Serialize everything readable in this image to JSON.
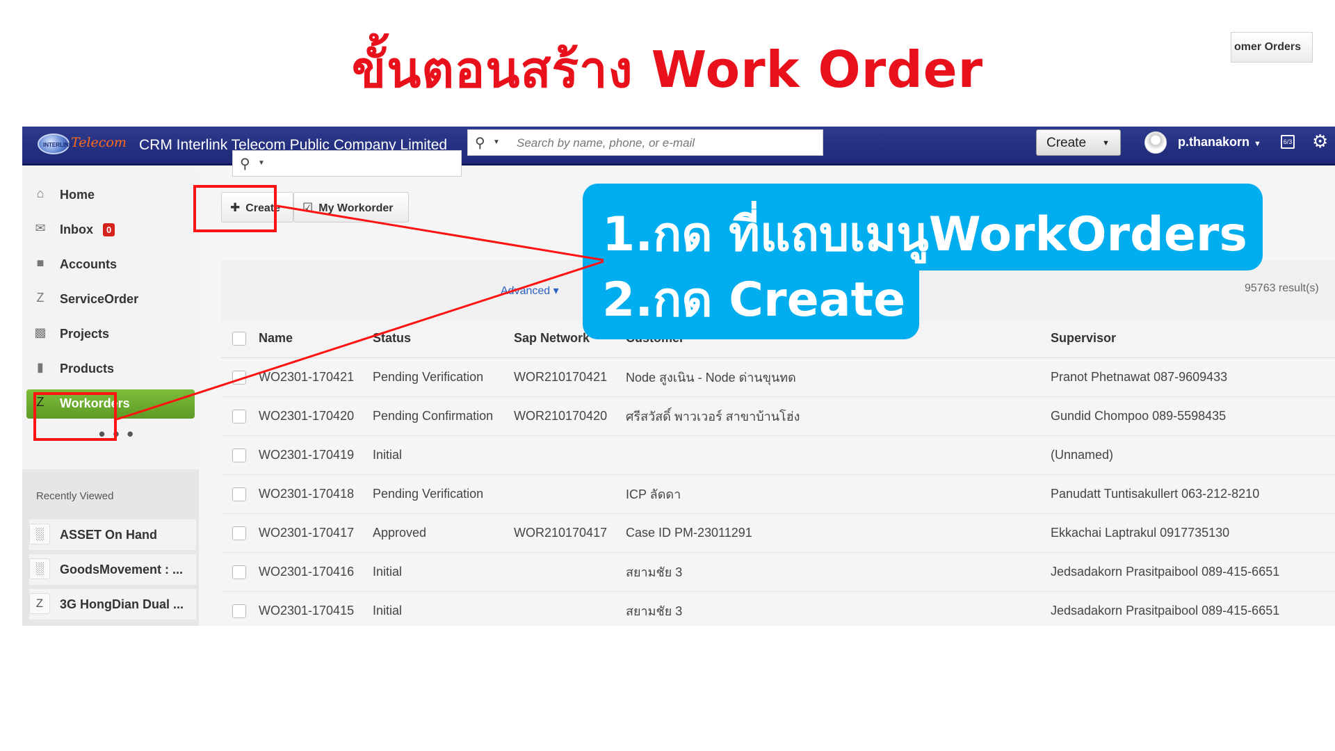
{
  "slide": {
    "title": "ขั้นตอนสร้าง Work Order"
  },
  "topbar": {
    "logo_text": "Telecom",
    "app_title": "CRM Interlink Telecom Public Company Limited",
    "search_placeholder": "Search by name, phone, or e-mail",
    "create_label": "Create",
    "username": "p.thanakorn",
    "icons": [
      "search-icon",
      "calendar-icon",
      "gear-icon"
    ]
  },
  "sidebar": {
    "items": [
      {
        "label": "Home",
        "icon": "home-icon"
      },
      {
        "label": "Inbox",
        "icon": "mail-icon",
        "badge": "0"
      },
      {
        "label": "Accounts",
        "icon": "folder-icon"
      },
      {
        "label": "ServiceOrder",
        "icon": "z-icon"
      },
      {
        "label": "Projects",
        "icon": "briefcase-icon"
      },
      {
        "label": "Products",
        "icon": "book-icon"
      },
      {
        "label": "Workorders",
        "icon": "z-icon",
        "active": true
      }
    ],
    "more": "• • •",
    "recent_title": "Recently Viewed",
    "recent_items": [
      {
        "label": "ASSET On Hand",
        "icon": "bar-chart-icon"
      },
      {
        "label": "GoodsMovement : ...",
        "icon": "bar-chart-icon"
      },
      {
        "label": "3G HongDian Dual ...",
        "icon": "z-icon"
      }
    ]
  },
  "toolbar": {
    "create_label": "Create",
    "my_workorder_label": "My Workorder",
    "customer_orders_label": "omer Orders",
    "advanced_label": "Advanced",
    "results_text": "95763 result(s)"
  },
  "table": {
    "headers": [
      "Name",
      "Status",
      "Sap Network",
      "Customer",
      "Supervisor"
    ],
    "rows": [
      {
        "name": "WO2301-170421",
        "status": "Pending Verification",
        "sap": "WOR210170421",
        "customer": "Node สูงเนิน - Node ด่านขุนทด",
        "supervisor": "Pranot Phetnawat 087-9609433"
      },
      {
        "name": "WO2301-170420",
        "status": "Pending Confirmation",
        "sap": "WOR210170420",
        "customer": "ศรีสวัสดิ์ พาวเวอร์ สาขาบ้านโฮ่ง",
        "supervisor": "Gundid Chompoo 089-5598435"
      },
      {
        "name": "WO2301-170419",
        "status": "Initial",
        "sap": "",
        "customer": "",
        "supervisor": "(Unnamed)"
      },
      {
        "name": "WO2301-170418",
        "status": "Pending Verification",
        "sap": "",
        "customer": "ICP ลัดดา",
        "supervisor": "Panudatt Tuntisakullert 063-212-8210"
      },
      {
        "name": "WO2301-170417",
        "status": "Approved",
        "sap": "WOR210170417",
        "customer": "Case ID PM-23011291",
        "supervisor": "Ekkachai Laptrakul 0917735130"
      },
      {
        "name": "WO2301-170416",
        "status": "Initial",
        "sap": "",
        "customer": "สยามชัย 3",
        "supervisor": "Jedsadakorn Prasitpaibool 089-415-6651"
      },
      {
        "name": "WO2301-170415",
        "status": "Initial",
        "sap": "",
        "customer": "สยามชัย 3",
        "supervisor": "Jedsadakorn Prasitpaibool 089-415-6651"
      }
    ]
  },
  "callout": {
    "line1": "1.กด ที่แถบเมนูWorkOrders",
    "line2": "2.กด Create"
  },
  "colors": {
    "title_red": "#e8101b",
    "callout_blue": "#00aeef",
    "nav_active_green": "#6aaa2e",
    "topbar_navy": "#26307f"
  }
}
